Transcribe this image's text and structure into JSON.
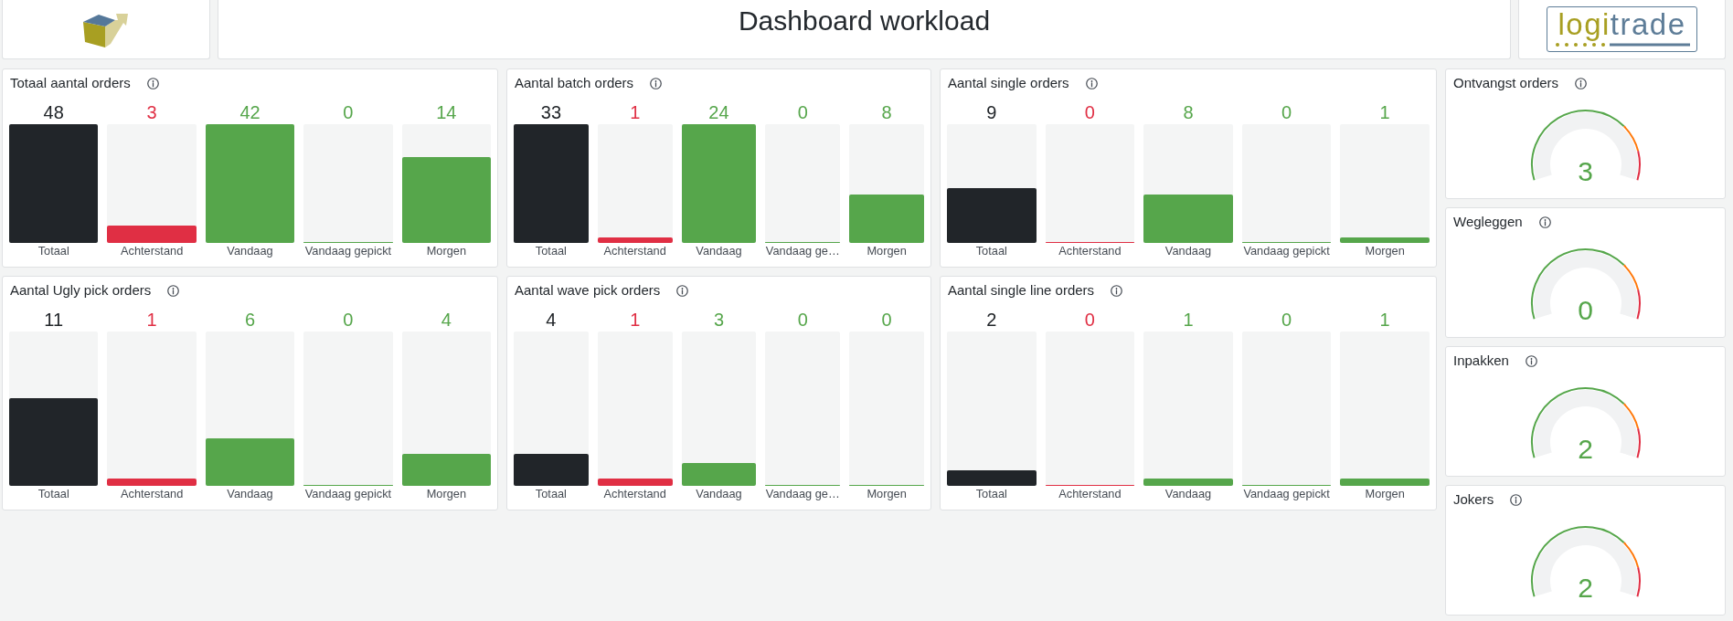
{
  "header": {
    "title": "Dashboard workload",
    "wordmark": [
      "logi",
      "trade"
    ]
  },
  "panels": [
    {
      "title": "Totaal aantal orders",
      "bars": [
        {
          "label": "Totaal",
          "value": "48",
          "level": 1,
          "color": "#212529"
        },
        {
          "label": "Achterstand",
          "value": "3",
          "level": 0.15,
          "color": "#e02f44"
        },
        {
          "label": "Vandaag",
          "value": "42",
          "level": 1,
          "color": "#56a64b"
        },
        {
          "label": "Vandaag gepickt",
          "value": "0",
          "level": 0,
          "color": "#56a64b"
        },
        {
          "label": "Morgen",
          "value": "14",
          "level": 0.72,
          "color": "#56a64b"
        }
      ]
    },
    {
      "title": "Aantal batch orders",
      "bars": [
        {
          "label": "Totaal",
          "value": "33",
          "level": 1,
          "color": "#212529"
        },
        {
          "label": "Achterstand",
          "value": "1",
          "level": 0.05,
          "color": "#e02f44"
        },
        {
          "label": "Vandaag",
          "value": "24",
          "level": 1,
          "color": "#56a64b"
        },
        {
          "label": "Vandaag ge…",
          "value": "0",
          "level": 0,
          "color": "#56a64b"
        },
        {
          "label": "Morgen",
          "value": "8",
          "level": 0.41,
          "color": "#56a64b"
        }
      ]
    },
    {
      "title": "Aantal single orders",
      "bars": [
        {
          "label": "Totaal",
          "value": "9",
          "level": 0.46,
          "color": "#212529"
        },
        {
          "label": "Achterstand",
          "value": "0",
          "level": 0,
          "color": "#e02f44"
        },
        {
          "label": "Vandaag",
          "value": "8",
          "level": 0.41,
          "color": "#56a64b"
        },
        {
          "label": "Vandaag gepickt",
          "value": "0",
          "level": 0,
          "color": "#56a64b"
        },
        {
          "label": "Morgen",
          "value": "1",
          "level": 0.05,
          "color": "#56a64b"
        }
      ]
    },
    {
      "title": "Aantal Ugly pick orders",
      "bars": [
        {
          "label": "Totaal",
          "value": "11",
          "level": 0.57,
          "color": "#212529"
        },
        {
          "label": "Achterstand",
          "value": "1",
          "level": 0.045,
          "color": "#e02f44"
        },
        {
          "label": "Vandaag",
          "value": "6",
          "level": 0.31,
          "color": "#56a64b"
        },
        {
          "label": "Vandaag gepickt",
          "value": "0",
          "level": 0,
          "color": "#56a64b"
        },
        {
          "label": "Morgen",
          "value": "4",
          "level": 0.21,
          "color": "#56a64b"
        }
      ]
    },
    {
      "title": "Aantal wave pick orders",
      "bars": [
        {
          "label": "Totaal",
          "value": "4",
          "level": 0.21,
          "color": "#212529"
        },
        {
          "label": "Achterstand",
          "value": "1",
          "level": 0.045,
          "color": "#e02f44"
        },
        {
          "label": "Vandaag",
          "value": "3",
          "level": 0.15,
          "color": "#56a64b"
        },
        {
          "label": "Vandaag ge…",
          "value": "0",
          "level": 0,
          "color": "#56a64b"
        },
        {
          "label": "Morgen",
          "value": "0",
          "level": 0,
          "color": "#56a64b"
        }
      ]
    },
    {
      "title": "Aantal single line orders",
      "bars": [
        {
          "label": "Totaal",
          "value": "2",
          "level": 0.1,
          "color": "#212529"
        },
        {
          "label": "Achterstand",
          "value": "0",
          "level": 0,
          "color": "#e02f44"
        },
        {
          "label": "Vandaag",
          "value": "1",
          "level": 0.048,
          "color": "#56a64b"
        },
        {
          "label": "Vandaag gepickt",
          "value": "0",
          "level": 0,
          "color": "#56a64b"
        },
        {
          "label": "Morgen",
          "value": "1",
          "level": 0.048,
          "color": "#56a64b"
        }
      ]
    }
  ],
  "gauges": [
    {
      "title": "Ontvangst orders",
      "value": "3"
    },
    {
      "title": "Wegleggen",
      "value": "0"
    },
    {
      "title": "Inpakken",
      "value": "2"
    },
    {
      "title": "Jokers",
      "value": "2"
    }
  ]
}
